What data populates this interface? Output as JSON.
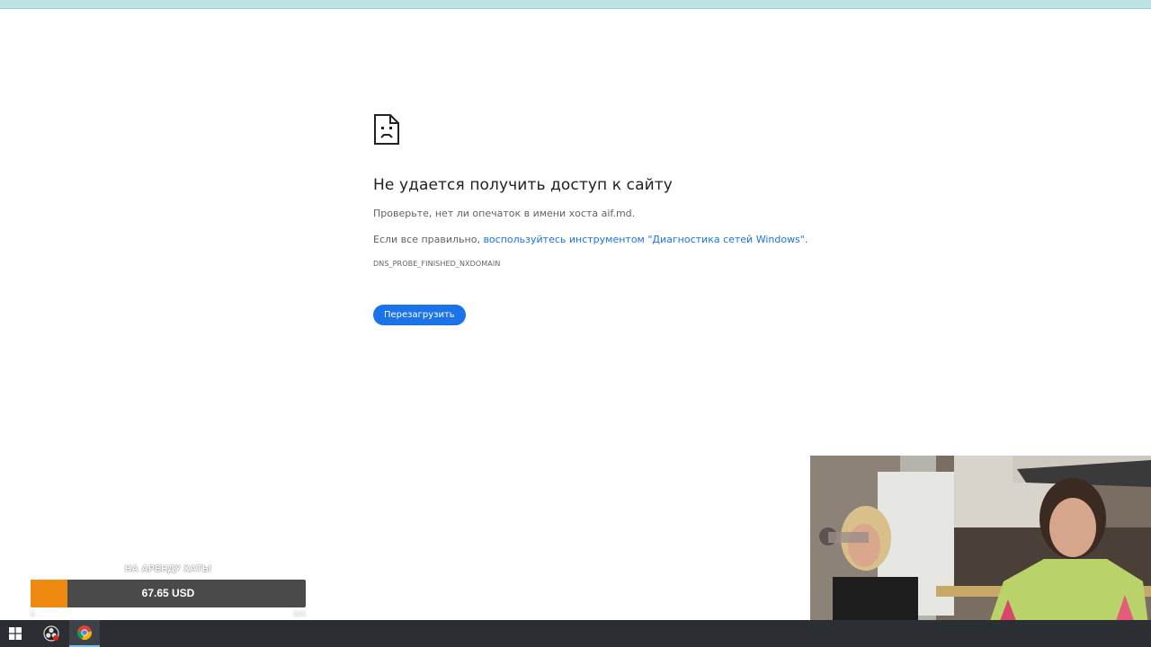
{
  "error_page": {
    "title": "Не удается получить доступ к сайту",
    "line1": "Проверьте, нет ли опечаток в имени хоста aif.md.",
    "line2_prefix": "Если все правильно, ",
    "line2_link": "воспользуйтесь инструментом \"Диагностика сетей Windows\"",
    "line2_suffix": ".",
    "error_code": "DNS_PROBE_FINISHED_NXDOMAIN",
    "reload_button": "Перезагрузить",
    "icon": "sad-page-icon"
  },
  "donation_widget": {
    "label": "НА АРЕНДУ ХАТЫ",
    "amount": "67.65 USD",
    "min": "0",
    "max": "500",
    "progress_fraction": 0.1353,
    "fill_color": "#ef8a10",
    "bar_color": "#4a4a4a"
  },
  "taskbar": {
    "items": [
      {
        "name": "windows-start-icon"
      },
      {
        "name": "obs-studio-icon"
      },
      {
        "name": "chrome-icon"
      }
    ]
  },
  "colors": {
    "link": "#1a73e8",
    "button": "#1a73e8",
    "taskbar": "#2b2f33"
  }
}
